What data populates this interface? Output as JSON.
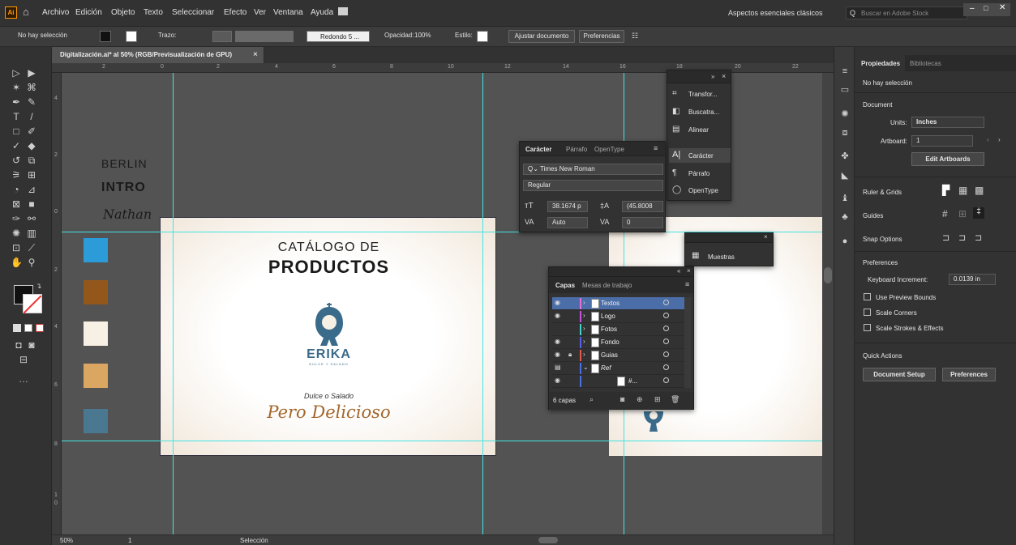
{
  "app": {
    "logo": "Ai",
    "workspace": "Aspectos esenciales clásicos",
    "search_placeholder": "Buscar en Adobe Stock"
  },
  "menu": [
    "Archivo",
    "Edición",
    "Objeto",
    "Texto",
    "Seleccionar",
    "Efecto",
    "Ver",
    "Ventana",
    "Ayuda"
  ],
  "control": {
    "selection": "No hay selección",
    "stroke_label": "Trazo:",
    "brush": "Redondo 5 ...",
    "opacity_label": "Opacidad:",
    "opacity": "100%",
    "style_label": "Estilo:",
    "fit_doc": "Ajustar documento",
    "prefs": "Preferencias"
  },
  "doc": {
    "tab": "Digitalización.ai* al 50% (RGB/Previsualización de GPU)",
    "close": "×"
  },
  "ruler_h": [
    "2",
    "0",
    "2",
    "4",
    "6",
    "8",
    "10",
    "12",
    "14",
    "16",
    "18",
    "20",
    "22"
  ],
  "ruler_v": [
    "4",
    "2",
    "0",
    "2",
    "4",
    "6",
    "8",
    "1",
    "0"
  ],
  "canvas": {
    "font1": "BERLIN",
    "font2": "INTRO",
    "font3": "Nathan",
    "swatches": [
      "#2b9cd8",
      "#93571c",
      "#f7f0e5",
      "#dba661",
      "#4a7890"
    ]
  },
  "artboard": {
    "title1": "CATÁLOGO DE",
    "title2": "PRODUCTOS",
    "brand": "ERIKA",
    "brand_sub": "DULCE Y SALADO",
    "tagline1": "Dulce o Salado",
    "tagline2": "Pero Delicioso",
    "brand_color": "#3b6b8a",
    "script_color": "#a3652a"
  },
  "panel_transform": {
    "items": [
      "Transfor...",
      "Buscatra...",
      "Alinear",
      "Carácter",
      "Párrafo",
      "OpenType"
    ]
  },
  "panel_char": {
    "tabs": [
      "Carácter",
      "Párrafo",
      "OpenType"
    ],
    "font": "Times New Roman",
    "style": "Regular",
    "size": "38.1674 p",
    "leading": "(45.8008",
    "kerning": "Auto",
    "tracking": "0"
  },
  "panel_samples": {
    "label": "Muestras"
  },
  "panel_layers": {
    "tabs": [
      "Capas",
      "Mesas de trabajo"
    ],
    "layers": [
      {
        "name": "Textos",
        "color": "#e86fd8"
      },
      {
        "name": "Logo",
        "color": "#c853e0"
      },
      {
        "name": "Fotos",
        "color": "#45d0c8"
      },
      {
        "name": "Fondo",
        "color": "#5562e8"
      },
      {
        "name": "Guias",
        "color": "#e35a4a"
      },
      {
        "name": "Ref",
        "color": "#4a6fe0"
      },
      {
        "name": "#...",
        "color": "#4a6fe0"
      }
    ],
    "count": "6 capas"
  },
  "props": {
    "tabs": [
      "Propiedades",
      "Bibliotecas"
    ],
    "no_sel": "No hay selección",
    "document": "Document",
    "units_label": "Units:",
    "units": "Inches",
    "artboard_label": "Artboard:",
    "artboard_value": "1",
    "edit_artboards": "Edit Artboards",
    "ruler_grids": "Ruler & Grids",
    "guides": "Guides",
    "snap": "Snap Options",
    "preferences": "Preferences",
    "keyboard_label": "Keyboard Increment:",
    "keyboard_value": "0.0139 in",
    "use_preview": "Use Preview Bounds",
    "scale_corners": "Scale Corners",
    "scale_strokes": "Scale Strokes & Effects",
    "quick_actions": "Quick Actions",
    "doc_setup": "Document Setup",
    "prefs_btn": "Preferences"
  },
  "status": {
    "zoom": "50%",
    "page": "1",
    "tool": "Selección"
  }
}
